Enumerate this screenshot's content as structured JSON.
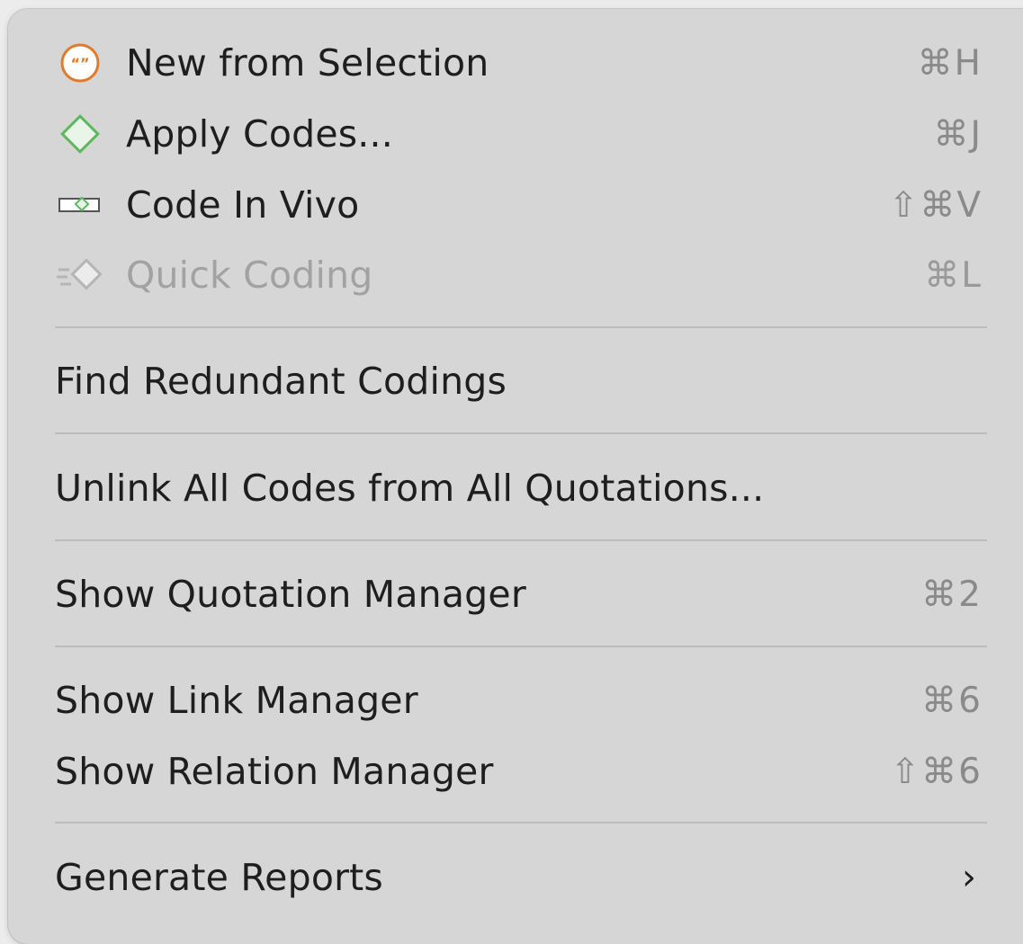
{
  "menu": {
    "items": [
      {
        "label": "New from Selection",
        "shortcut": "⌘H",
        "icon": "quotation-icon",
        "enabled": true
      },
      {
        "label": "Apply Codes...",
        "shortcut": "⌘J",
        "icon": "code-diamond-icon",
        "enabled": true
      },
      {
        "label": "Code In Vivo",
        "shortcut": "⇧⌘V",
        "icon": "in-vivo-code-icon",
        "enabled": true
      },
      {
        "label": "Quick Coding",
        "shortcut": "⌘L",
        "icon": "quick-coding-icon",
        "enabled": false
      },
      {
        "label": "Find Redundant Codings",
        "shortcut": "",
        "enabled": true
      },
      {
        "label": "Unlink All Codes from All Quotations...",
        "shortcut": "",
        "enabled": true
      },
      {
        "label": "Show Quotation Manager",
        "shortcut": "⌘2",
        "enabled": true
      },
      {
        "label": "Show Link Manager",
        "shortcut": "⌘6",
        "enabled": true
      },
      {
        "label": "Show Relation Manager",
        "shortcut": "⇧⌘6",
        "enabled": true
      },
      {
        "label": "Generate Reports",
        "submenu_indicator": "›",
        "enabled": true
      }
    ]
  },
  "colors": {
    "menu_background": "#d6d6d6",
    "text": "#1e1e1e",
    "disabled_text": "#a2a2a2",
    "shortcut_text": "#8a8a8a",
    "separator": "#bcbcbc",
    "quotation_icon_accent": "#e07a2e",
    "code_icon_accent": "#5cb85c"
  }
}
